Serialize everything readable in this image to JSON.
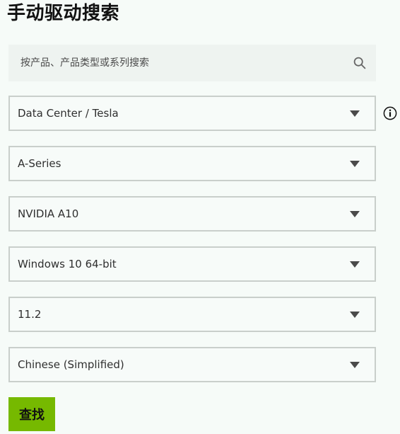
{
  "page": {
    "title": "手动驱动搜索"
  },
  "search": {
    "placeholder": "按产品、产品类型或系列搜索",
    "icon": "search-icon"
  },
  "form": {
    "fields": [
      {
        "id": "product-type",
        "value": "Data Center / Tesla",
        "icon": "chevron-down-icon"
      },
      {
        "id": "product-series",
        "value": "A-Series",
        "icon": "chevron-down-icon"
      },
      {
        "id": "product",
        "value": "NVIDIA A10",
        "icon": "chevron-down-icon"
      },
      {
        "id": "operating-system",
        "value": "Windows 10 64-bit",
        "icon": "chevron-down-icon"
      },
      {
        "id": "cuda-toolkit",
        "value": "11.2",
        "icon": "chevron-down-icon"
      },
      {
        "id": "language",
        "value": "Chinese (Simplified)",
        "icon": "chevron-down-icon"
      }
    ],
    "info_icon": "info-icon",
    "submit_label": "查找",
    "accent_color": "#76b900"
  }
}
